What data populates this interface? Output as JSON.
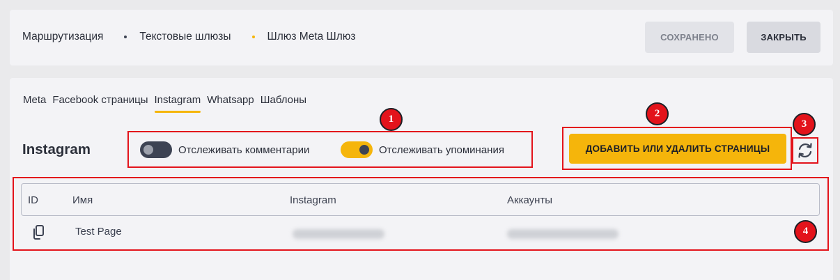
{
  "header": {
    "breadcrumbs": [
      {
        "label": "Маршрутизация"
      },
      {
        "label": "Текстовые шлюзы",
        "dot_color": "#3d4353"
      },
      {
        "label": "Шлюз Meta Шлюз",
        "dot_color": "#f5b50b"
      }
    ],
    "saved_label": "СОХРАНЕНО",
    "close_label": "ЗАКРЫТЬ"
  },
  "tabs": [
    {
      "label": "Meta",
      "active": false
    },
    {
      "label": "Facebook страницы",
      "active": false
    },
    {
      "label": "Instagram",
      "active": true
    },
    {
      "label": "Whatsapp",
      "active": false
    },
    {
      "label": "Шаблоны",
      "active": false
    }
  ],
  "section": {
    "title": "Instagram",
    "toggles": [
      {
        "label": "Отслеживать комментарии",
        "on": false
      },
      {
        "label": "Отслеживать упоминания",
        "on": true
      }
    ],
    "add_button_label": "ДОБАВИТЬ ИЛИ УДАЛИТЬ СТРАНИЦЫ",
    "refresh_icon": "refresh-icon"
  },
  "table": {
    "columns": [
      "ID",
      "Имя",
      "Instagram",
      "Аккаунты"
    ],
    "rows": [
      {
        "id_icon": "copy-icon",
        "name": "Test Page",
        "instagram": "",
        "accounts": ""
      }
    ]
  },
  "annotations": [
    "1",
    "2",
    "3",
    "4"
  ],
  "colors": {
    "accent": "#f5b50b",
    "highlight": "#e3131b",
    "dark": "#3d4353"
  }
}
